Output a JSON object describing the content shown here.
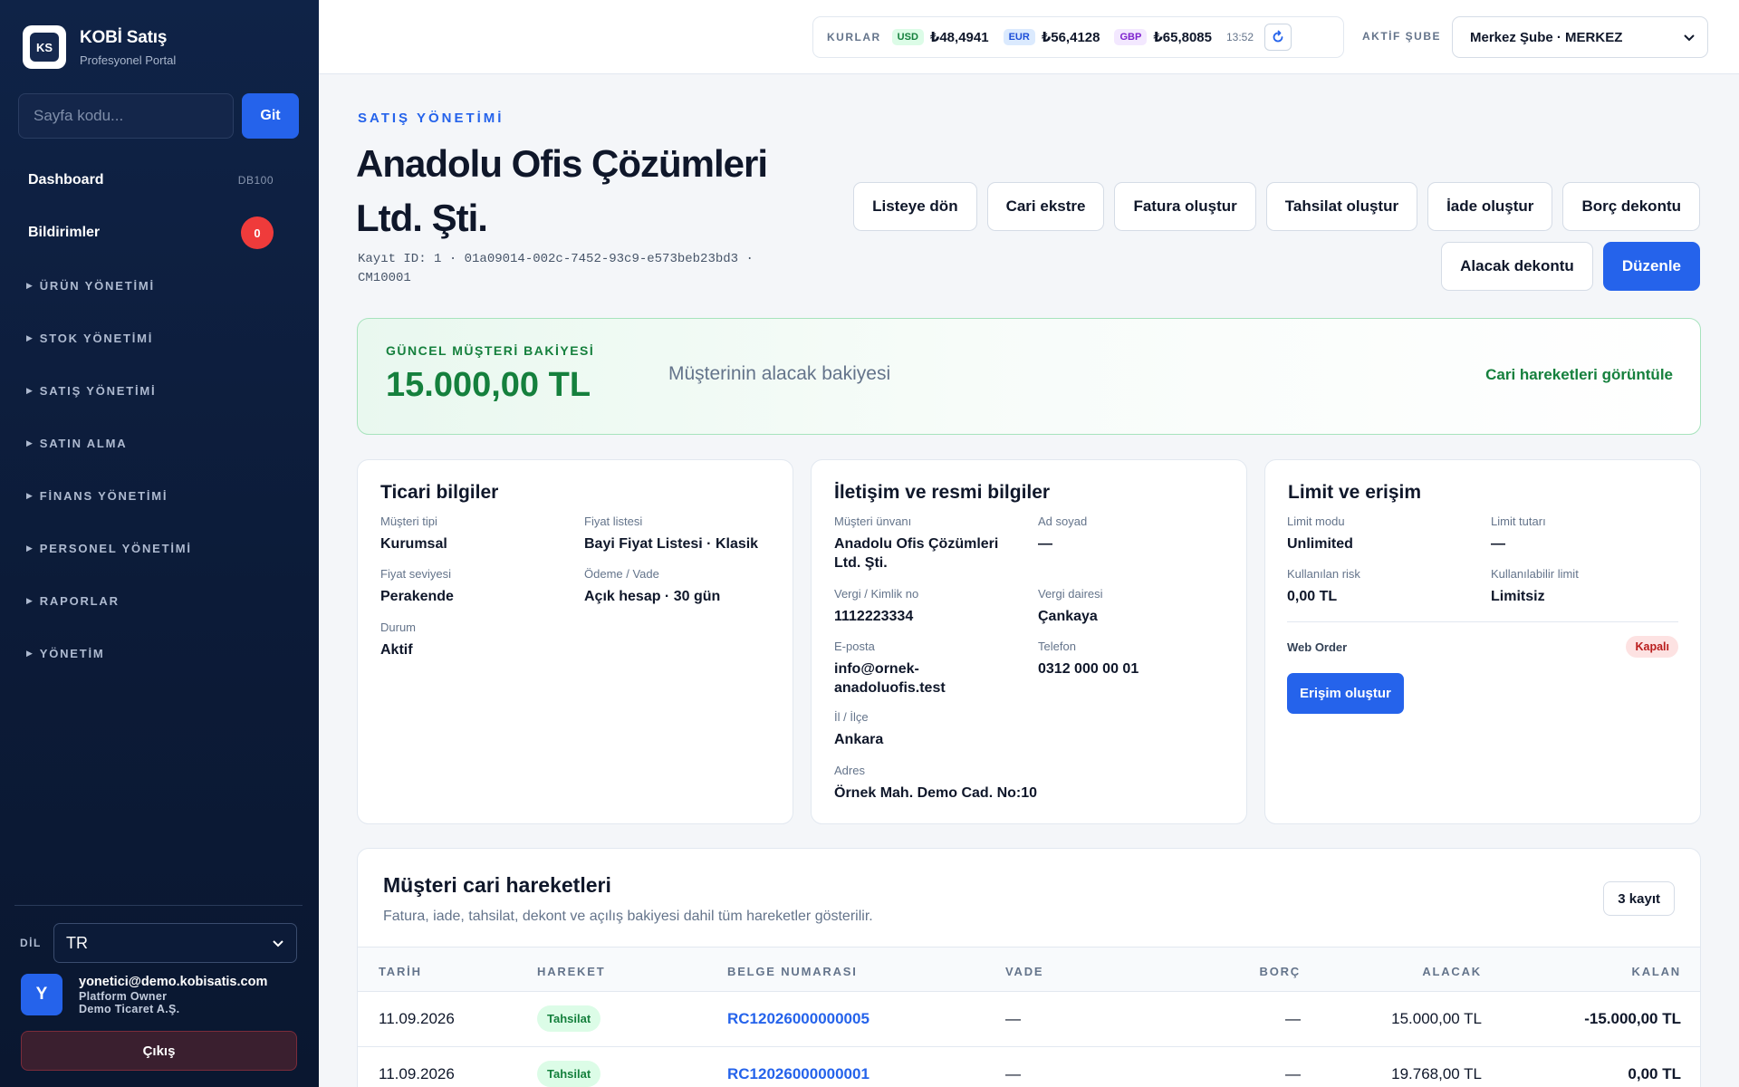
{
  "sidebar": {
    "brand_title": "KOBİ Satış",
    "brand_sub": "Profesyonel Portal",
    "logo_text": "KS",
    "page_code_placeholder": "Sayfa kodu...",
    "go_label": "Git",
    "dashboard": {
      "label": "Dashboard",
      "code": "DB100"
    },
    "notifications": {
      "label": "Bildirimler",
      "count": "0"
    },
    "sections": [
      "ÜRÜN YÖNETİMİ",
      "STOK YÖNETİMİ",
      "SATIŞ YÖNETİMİ",
      "SATIN ALMA",
      "FİNANS YÖNETİMİ",
      "PERSONEL YÖNETİMİ",
      "RAPORLAR",
      "YÖNETİM"
    ],
    "lang_label": "DİL",
    "lang_value": "TR",
    "user": {
      "initial": "Y",
      "email": "yonetici@demo.kobisatis.com",
      "role": "Platform Owner",
      "company": "Demo Ticaret A.Ş."
    },
    "logout_label": "Çıkış"
  },
  "topbar": {
    "rates_label": "KURLAR",
    "rates": [
      {
        "code": "USD",
        "value": "₺48,4941"
      },
      {
        "code": "EUR",
        "value": "₺56,4128"
      },
      {
        "code": "GBP",
        "value": "₺65,8085"
      }
    ],
    "time": "13:52",
    "branch_label": "AKTİF ŞUBE",
    "branch_value": "Merkez Şube · MERKEZ"
  },
  "header": {
    "eyebrow": "SATIŞ YÖNETİMİ",
    "title": "Anadolu Ofis Çözümleri Ltd. Şti.",
    "record": "Kayıt ID: 1 · 01a09014-002c-7452-93c9-e573beb23bd3 · CM10001"
  },
  "actions": {
    "back": "Listeye dön",
    "statement": "Cari ekstre",
    "invoice": "Fatura oluştur",
    "collection": "Tahsilat oluştur",
    "refund": "İade oluştur",
    "debit_note": "Borç dekontu",
    "credit_note": "Alacak dekontu",
    "edit": "Düzenle"
  },
  "balance": {
    "label": "GÜNCEL MÜŞTERİ BAKİYESİ",
    "value": "15.000,00 TL",
    "desc": "Müşterinin alacak bakiyesi",
    "link": "Cari hareketleri görüntüle"
  },
  "commercial": {
    "title": "Ticari bilgiler",
    "fields": [
      {
        "k": "Müşteri tipi",
        "v": "Kurumsal"
      },
      {
        "k": "Fiyat listesi",
        "v": "Bayi Fiyat Listesi · Klasik"
      },
      {
        "k": "Fiyat seviyesi",
        "v": "Perakende"
      },
      {
        "k": "Ödeme / Vade",
        "v": "Açık hesap · 30 gün"
      },
      {
        "k": "Durum",
        "v": "Aktif"
      }
    ]
  },
  "contact": {
    "title": "İletişim ve resmi bilgiler",
    "fields": [
      {
        "k": "Müşteri ünvanı",
        "v": "Anadolu Ofis Çözümleri Ltd. Şti."
      },
      {
        "k": "Ad soyad",
        "v": "—"
      },
      {
        "k": "Vergi / Kimlik no",
        "v": "1112223334"
      },
      {
        "k": "Vergi dairesi",
        "v": "Çankaya"
      },
      {
        "k": "E-posta",
        "v": "info@ornek-anadoluofis.test"
      },
      {
        "k": "Telefon",
        "v": "0312 000 00 01"
      },
      {
        "k": "İl / İlçe",
        "v": "Ankara"
      },
      {
        "k": "Adres",
        "v": "Örnek Mah. Demo Cad. No:10"
      }
    ]
  },
  "limit": {
    "title": "Limit ve erişim",
    "fields": [
      {
        "k": "Limit modu",
        "v": "Unlimited"
      },
      {
        "k": "Limit tutarı",
        "v": "—"
      },
      {
        "k": "Kullanılan risk",
        "v": "0,00 TL"
      },
      {
        "k": "Kullanılabilir limit",
        "v": "Limitsiz"
      }
    ],
    "web_order_label": "Web Order",
    "web_order_status": "Kapalı",
    "access_button": "Erişim oluştur"
  },
  "movements": {
    "title": "Müşteri cari hareketleri",
    "subtitle": "Fatura, iade, tahsilat, dekont ve açılış bakiyesi dahil tüm hareketler gösterilir.",
    "count": "3 kayıt",
    "columns": [
      "TARİH",
      "HAREKET",
      "BELGE NUMARASI",
      "VADE",
      "BORÇ",
      "ALACAK",
      "KALAN"
    ],
    "rows": [
      {
        "date": "11.09.2026",
        "type": "Tahsilat",
        "doc": "RC12026000000005",
        "due": "—",
        "debit": "—",
        "credit": "15.000,00 TL",
        "balance": "-15.000,00 TL"
      },
      {
        "date": "11.09.2026",
        "type": "Tahsilat",
        "doc": "RC12026000000001",
        "due": "—",
        "debit": "—",
        "credit": "19.768,00 TL",
        "balance": "0,00 TL"
      }
    ]
  },
  "colors": {
    "accent": "#2563eb",
    "success": "#15803d",
    "sidebar": "#0f2347",
    "danger": "#ef3b3b"
  }
}
